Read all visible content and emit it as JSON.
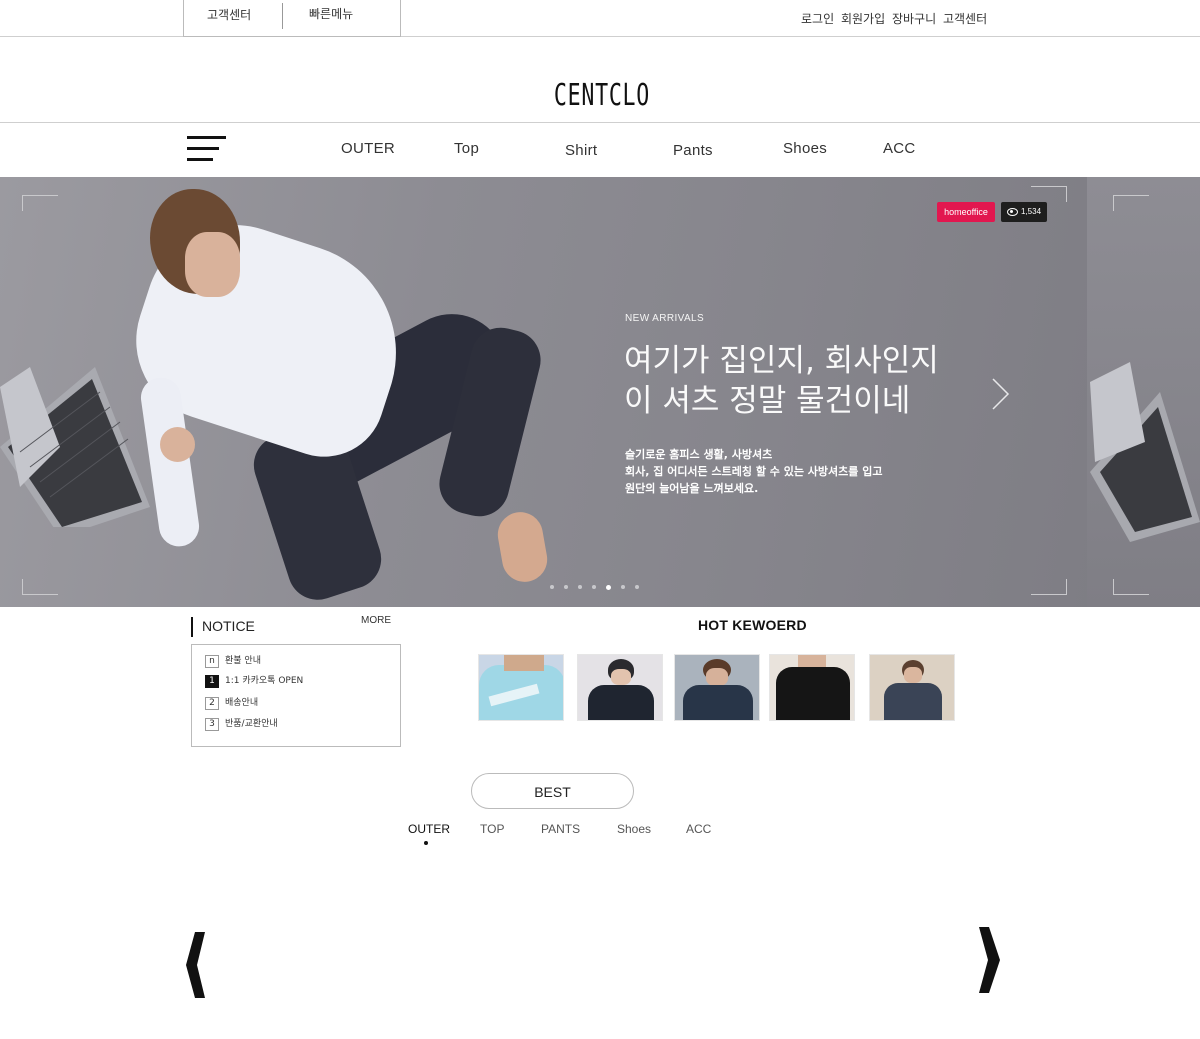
{
  "topbar": {
    "cs_label": "고객센터",
    "quick_label": "빠른메뉴",
    "links": [
      "로그인",
      "회원가입",
      "장바구니",
      "고객센터"
    ]
  },
  "logo": "CENTCLO",
  "nav": {
    "items": [
      "OUTER",
      "Top",
      "Shirt",
      "Pants",
      "Shoes",
      "ACC"
    ]
  },
  "hero": {
    "badge": "homeoffice",
    "view_count": "1,534",
    "eyebrow": "NEW ARRIVALS",
    "title_line1": "여기가 집인지, 회사인지",
    "title_line2": "이 셔츠 정말 물건이네",
    "desc_line1": "슬기로운 홈피스 생활, 사방셔츠",
    "desc_line2": "회사, 집 어디서든 스트레칭 할 수 있는 사방셔츠를 입고",
    "desc_line3": "원단의 늘어남을 느껴보세요.",
    "slide_count": 7,
    "active_slide": 5
  },
  "notice": {
    "title": "NOTICE",
    "more": "MORE",
    "items": [
      {
        "num": "n",
        "text": "환불 안내"
      },
      {
        "num": "1",
        "text": "1:1 카카오톡 OPEN"
      },
      {
        "num": "2",
        "text": "배송안내"
      },
      {
        "num": "3",
        "text": "반품/교환안내"
      }
    ]
  },
  "hot": {
    "title": "HOT KEWOERD"
  },
  "best": {
    "button": "BEST",
    "tabs": [
      "OUTER",
      "TOP",
      "PANTS",
      "Shoes",
      "ACC"
    ],
    "active_tab": "OUTER"
  },
  "colors": {
    "accent_badge": "#e2174f",
    "text_dark": "#111111"
  }
}
